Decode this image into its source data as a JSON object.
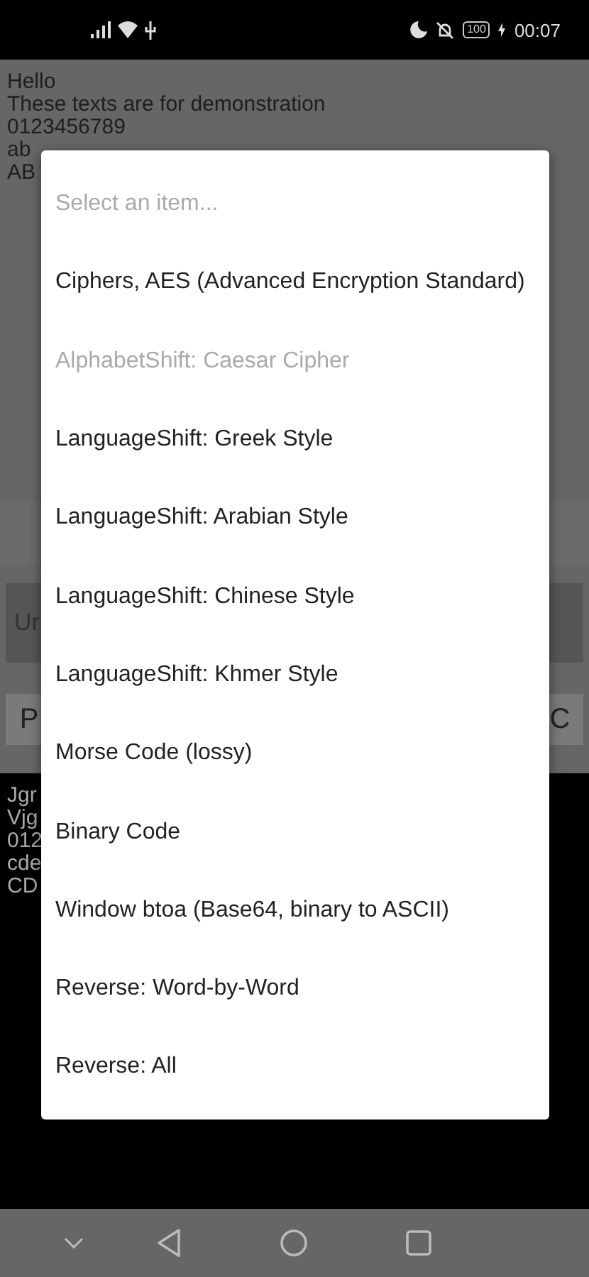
{
  "status_bar": {
    "battery": "100",
    "time": "00:07"
  },
  "background": {
    "texts": [
      "Hello",
      "These texts are for demonstration",
      "0123456789",
      "ab",
      "AB"
    ],
    "field_text": "Ur",
    "buttons": [
      "P",
      "C"
    ],
    "output_lines": [
      "Jgr",
      "Vjg",
      "012",
      "cde",
      "CD"
    ]
  },
  "dialog": {
    "placeholder": "Select an item...",
    "items": [
      {
        "label": "Ciphers, AES (Advanced Encryption Standard)",
        "disabled": false
      },
      {
        "label": "AlphabetShift: Caesar Cipher",
        "disabled": true
      },
      {
        "label": "LanguageShift: Greek Style",
        "disabled": false
      },
      {
        "label": "LanguageShift: Arabian Style",
        "disabled": false
      },
      {
        "label": "LanguageShift: Chinese Style",
        "disabled": false
      },
      {
        "label": "LanguageShift: Khmer Style",
        "disabled": false
      },
      {
        "label": "Morse Code (lossy)",
        "disabled": false
      },
      {
        "label": "Binary Code",
        "disabled": false
      },
      {
        "label": "Window btoa (Base64, binary to ASCII)",
        "disabled": false
      },
      {
        "label": "Reverse: Word-by-Word",
        "disabled": false
      },
      {
        "label": "Reverse: All",
        "disabled": false
      }
    ]
  }
}
